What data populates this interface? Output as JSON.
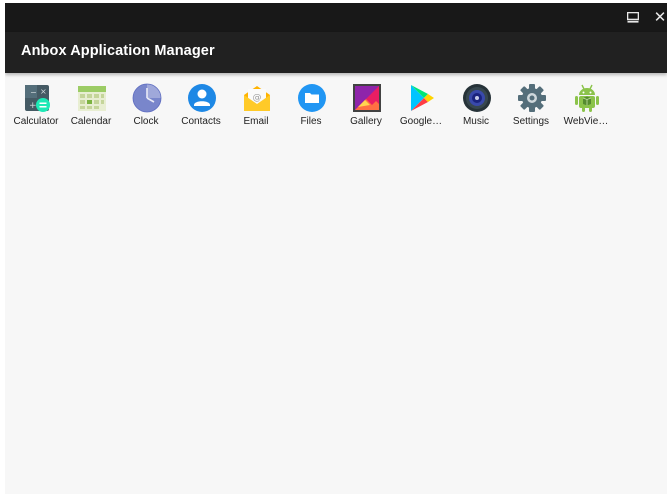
{
  "window": {
    "title": "Anbox Application Manager",
    "controls": [
      {
        "name": "restore",
        "icon": "restore-window-icon"
      },
      {
        "name": "close",
        "icon": "close-icon",
        "glyph": "✕"
      }
    ]
  },
  "apps": [
    {
      "label": "Calculator",
      "icon": "calculator-icon"
    },
    {
      "label": "Calendar",
      "icon": "calendar-icon"
    },
    {
      "label": "Clock",
      "icon": "clock-icon"
    },
    {
      "label": "Contacts",
      "icon": "contacts-icon"
    },
    {
      "label": "Email",
      "icon": "email-icon"
    },
    {
      "label": "Files",
      "icon": "files-icon"
    },
    {
      "label": "Gallery",
      "icon": "gallery-icon"
    },
    {
      "label": "Google…",
      "icon": "google-play-icon"
    },
    {
      "label": "Music",
      "icon": "music-icon"
    },
    {
      "label": "Settings",
      "icon": "settings-gear-icon"
    },
    {
      "label": "WebVie…",
      "icon": "android-webview-icon"
    }
  ],
  "colors": {
    "titlebar": "#181818",
    "appbar": "#212121",
    "background": "#f7f7f7"
  }
}
